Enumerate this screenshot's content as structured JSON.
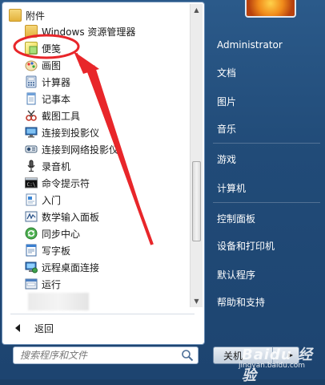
{
  "colors": {
    "accent_red": "#e8262a",
    "panel_blue": "#214b78",
    "panel_white": "#ffffff"
  },
  "programs": [
    {
      "label": "附件",
      "icon": "folder-icon"
    },
    {
      "label": "Windows 资源管理器",
      "icon": "folder-icon"
    },
    {
      "label": "便笺",
      "icon": "sticky-notes-icon"
    },
    {
      "label": "画图",
      "icon": "paint-icon"
    },
    {
      "label": "计算器",
      "icon": "calculator-icon"
    },
    {
      "label": "记事本",
      "icon": "notepad-icon"
    },
    {
      "label": "截图工具",
      "icon": "snipping-tool-icon"
    },
    {
      "label": "连接到投影仪",
      "icon": "projector-icon"
    },
    {
      "label": "连接到网络投影仪",
      "icon": "network-projector-icon"
    },
    {
      "label": "录音机",
      "icon": "microphone-icon"
    },
    {
      "label": "命令提示符",
      "icon": "cmd-icon"
    },
    {
      "label": "入门",
      "icon": "getting-started-icon"
    },
    {
      "label": "数学输入面板",
      "icon": "math-panel-icon"
    },
    {
      "label": "同步中心",
      "icon": "sync-icon"
    },
    {
      "label": "写字板",
      "icon": "wordpad-icon"
    },
    {
      "label": "远程桌面连接",
      "icon": "remote-desktop-icon"
    },
    {
      "label": "运行",
      "icon": "run-icon"
    }
  ],
  "back_label": "返回",
  "search": {
    "placeholder": "搜索程序和文件"
  },
  "right_items": [
    {
      "label": "Administrator"
    },
    {
      "label": "文档"
    },
    {
      "label": "图片"
    },
    {
      "label": "音乐"
    },
    {
      "label": "游戏"
    },
    {
      "label": "计算机"
    },
    {
      "label": "控制面板"
    },
    {
      "label": "设备和打印机"
    },
    {
      "label": "默认程序"
    },
    {
      "label": "帮助和支持"
    }
  ],
  "shutdown_label": "关机",
  "watermark": {
    "brand": "Baidu 经验",
    "url": "jingyan.baidu.com"
  }
}
